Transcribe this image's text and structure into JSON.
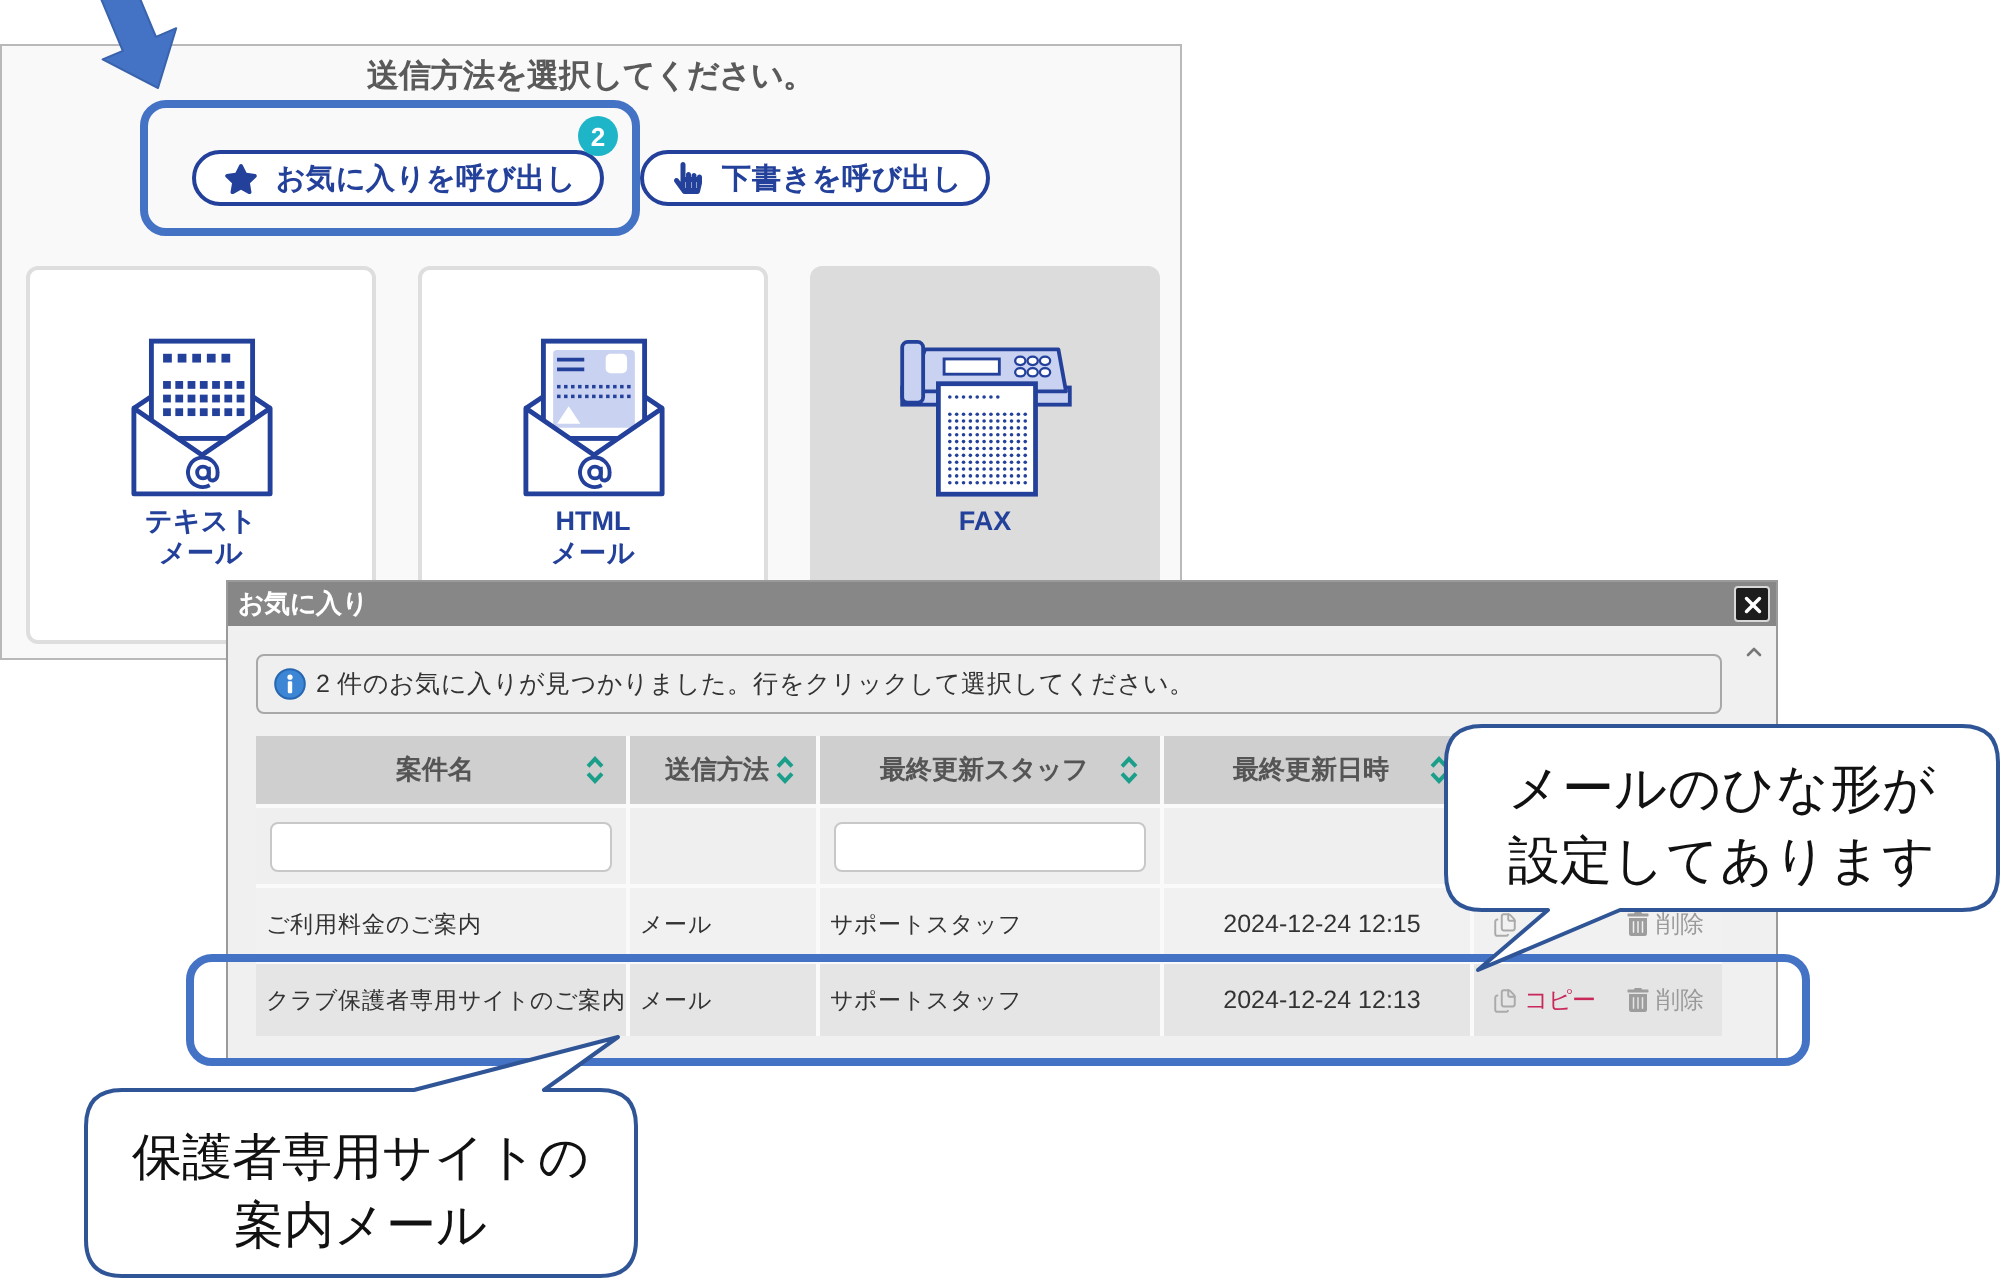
{
  "header": {
    "title": "送信方法を選択してください。"
  },
  "launch_buttons": [
    {
      "kind": "favorites",
      "label": "お気に入りを呼び出し",
      "badge": "2"
    },
    {
      "kind": "drafts",
      "label": "下書きを呼び出し"
    }
  ],
  "send_methods": [
    {
      "kind": "text_mail",
      "label": "テキストメール",
      "selected": false
    },
    {
      "kind": "html_mail",
      "label": "HTML\nメール",
      "selected": false
    },
    {
      "kind": "fax",
      "label": "FAX",
      "selected": true
    }
  ],
  "dialog": {
    "title": "お気に入り",
    "info": "2 件のお気に入りが見つかりました。行をクリックして選択してください。",
    "columns": [
      {
        "label": "案件名",
        "filter": true
      },
      {
        "label": "送信方法",
        "filter": false
      },
      {
        "label": "最終更新スタッフ",
        "filter": true
      },
      {
        "label": "最終更新日時",
        "filter": false
      }
    ],
    "rows": [
      {
        "cells": [
          "ご利用料金のご案内",
          "メール",
          "サポートスタッフ",
          "2024-12-24 12:15"
        ],
        "actions": [
          {
            "kind": "copy"
          },
          {
            "kind": "delete",
            "label": "削除"
          }
        ],
        "selected": false
      },
      {
        "cells": [
          "クラブ保護者専用サイトのご案内",
          "メール",
          "サポートスタッフ",
          "2024-12-24 12:13"
        ],
        "actions": [
          {
            "kind": "copy",
            "label": "コピー"
          },
          {
            "kind": "delete",
            "label": "削除"
          }
        ],
        "selected": true
      }
    ]
  },
  "callouts": [
    {
      "text": "メールのひな形が設定してあります"
    },
    {
      "text": "保護者専用サイトの案内メール"
    }
  ]
}
